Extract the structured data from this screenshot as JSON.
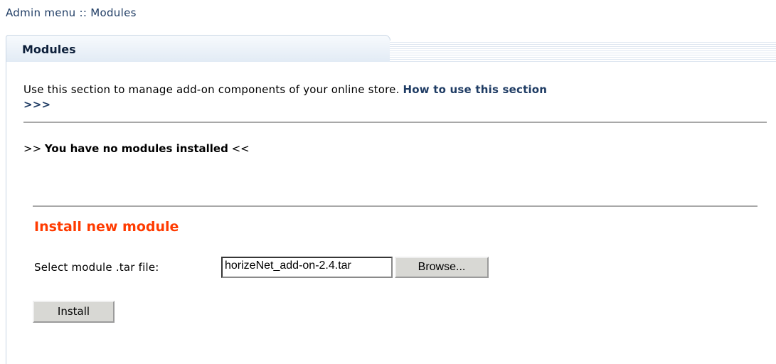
{
  "breadcrumb": {
    "text": "Admin menu  :: Modules"
  },
  "panel": {
    "title": "Modules"
  },
  "intro": {
    "text": "Use this section to manage add-on components of your online store. ",
    "help_link": "How to use this section",
    "help_arrows": ">>>"
  },
  "status": {
    "prefix": ">> ",
    "message": "You have no modules installed",
    "suffix": " <<"
  },
  "install": {
    "title": "Install new module",
    "file_label": "Select module .tar file:",
    "file_value": "horizeNet_add-on-2.4.tar",
    "browse_label": "Browse...",
    "install_label": "Install",
    "title_color": "#ff3b00"
  }
}
